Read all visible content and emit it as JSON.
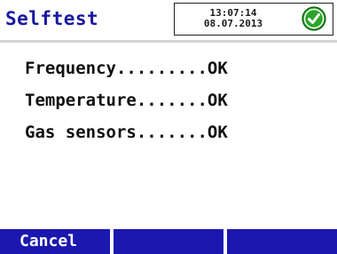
{
  "header": {
    "title": "Selftest",
    "time": "13:07:14",
    "date": "08.07.2013",
    "status_icon": "check-circle-icon"
  },
  "results": [
    {
      "label": "Frequency.........",
      "status": "OK"
    },
    {
      "label": "Temperature.......",
      "status": "OK"
    },
    {
      "label": "Gas sensors.......",
      "status": "OK"
    }
  ],
  "softkeys": [
    {
      "label": "Cancel"
    },
    {
      "label": ""
    },
    {
      "label": ""
    }
  ],
  "colors": {
    "title": "#1818a0",
    "softkey_bg": "#1b18b0",
    "ok_green": "#2ca52c"
  }
}
